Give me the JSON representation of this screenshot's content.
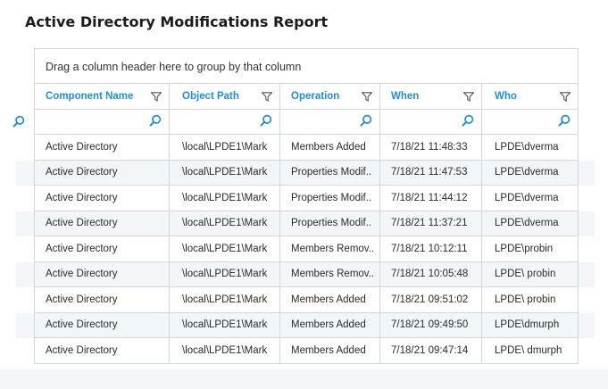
{
  "title": "Active Directory Modifications Report",
  "group_panel_text": "Drag a column header here to group by that column",
  "columns": [
    "Component Name",
    "Object Path",
    "Operation",
    "When",
    "Who"
  ],
  "rows": [
    [
      "Active Directory",
      "\\local\\LPDE1\\Mark",
      "Members Added",
      "7/18/21  11:48:33",
      "LPDE\\dverma"
    ],
    [
      "Active Directory",
      "\\local\\LPDE1\\Mark",
      "Properties Modif..",
      "7/18/21  11:47:53",
      "LPDE\\dverma"
    ],
    [
      "Active Directory",
      "\\local\\LPDE1\\Mark",
      "Properties Modif..",
      "7/18/21  11:44:12",
      "LPDE\\dverma"
    ],
    [
      "Active Directory",
      "\\local\\LPDE1\\Mark",
      "Properties Modif..",
      "7/18/21  11:37:21",
      "LPDE\\dverma"
    ],
    [
      "Active Directory",
      "\\local\\LPDE1\\Mark",
      "Members Remov..",
      "7/18/21  10:12:11",
      "LPDE\\probin"
    ],
    [
      "Active Directory",
      "\\local\\LPDE1\\Mark",
      "Members Remov..",
      "7/18/21  10:05:48",
      "LPDE\\ probin"
    ],
    [
      "Active Directory",
      "\\local\\LPDE1\\Mark",
      "Members Added",
      "7/18/21  09:51:02",
      "LPDE\\ probin"
    ],
    [
      "Active Directory",
      "\\local\\LPDE1\\Mark",
      "Members Added",
      "7/18/21  09:49:50",
      "LPDE\\dmurph"
    ],
    [
      "Active Directory",
      "\\local\\LPDE1\\Mark",
      "Members Added",
      "7/18/21  09:47:14",
      "LPDE\\ dmurph"
    ]
  ],
  "icons": {
    "filter": "filter-icon",
    "search": "search-icon"
  },
  "colors": {
    "header_text": "#1f8ed6",
    "stripe": "#f3f6f9",
    "border": "#cfd6dc"
  }
}
